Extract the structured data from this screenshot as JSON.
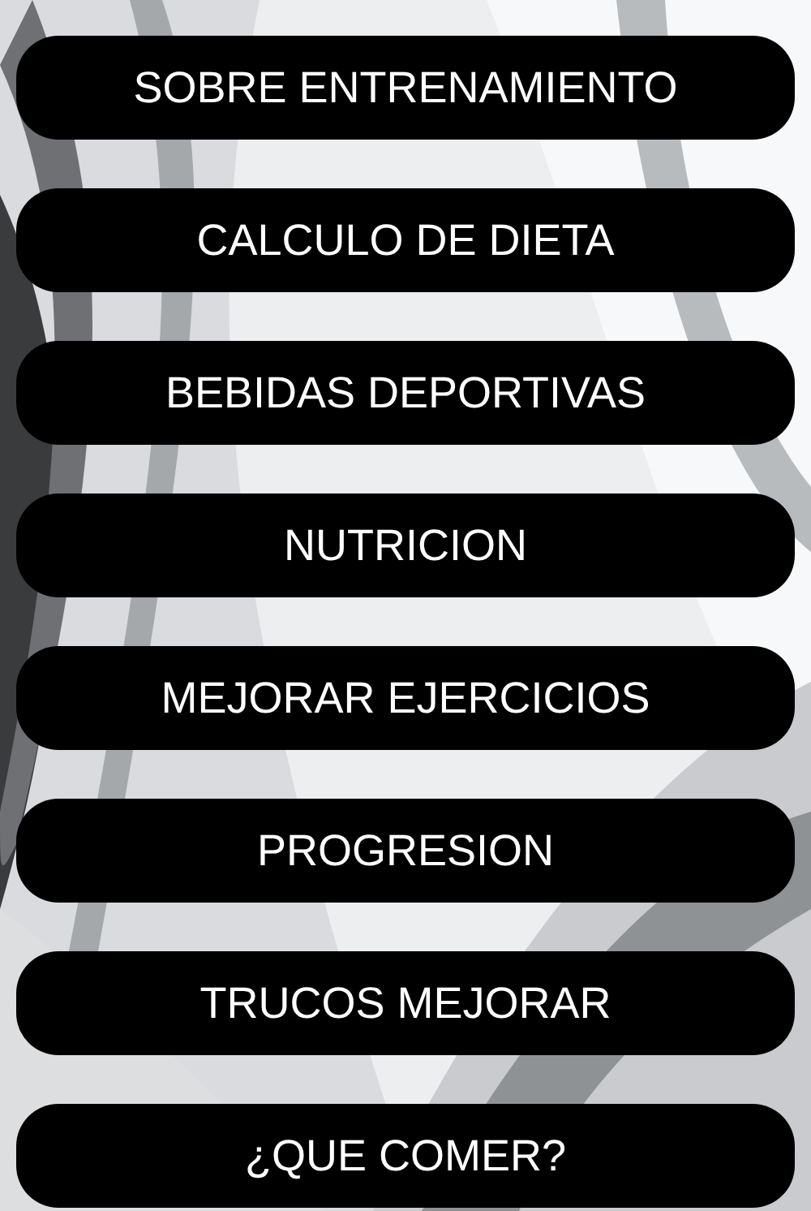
{
  "menu": [
    {
      "label": "SOBRE ENTRENAMIENTO"
    },
    {
      "label": "CALCULO DE DIETA"
    },
    {
      "label": "BEBIDAS DEPORTIVAS"
    },
    {
      "label": "NUTRICION"
    },
    {
      "label": "MEJORAR EJERCICIOS"
    },
    {
      "label": "PROGRESION"
    },
    {
      "label": "TRUCOS MEJORAR"
    },
    {
      "label": "¿QUE COMER?"
    }
  ]
}
